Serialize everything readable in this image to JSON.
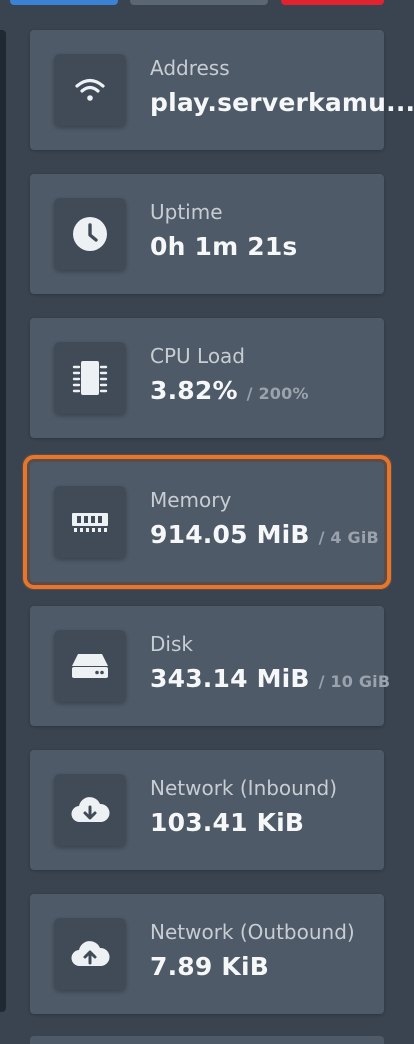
{
  "stats": [
    {
      "icon": "wifi-icon",
      "label": "Address",
      "value": "play.serverkamu....",
      "limit": ""
    },
    {
      "icon": "clock-icon",
      "label": "Uptime",
      "value": "0h 1m 21s",
      "limit": ""
    },
    {
      "icon": "cpu-chip-icon",
      "label": "CPU Load",
      "value": "3.82%",
      "limit": "/ 200%"
    },
    {
      "icon": "memory-icon",
      "label": "Memory",
      "value": "914.05 MiB",
      "limit": "/ 4 GiB"
    },
    {
      "icon": "hard-drive-icon",
      "label": "Disk",
      "value": "343.14 MiB",
      "limit": "/ 10 GiB"
    },
    {
      "icon": "cloud-download-icon",
      "label": "Network (Inbound)",
      "value": "103.41 KiB",
      "limit": ""
    },
    {
      "icon": "cloud-upload-icon",
      "label": "Network (Outbound)",
      "value": "7.89 KiB",
      "limit": ""
    }
  ],
  "colors": {
    "background": "#3a4450",
    "card": "#4e5a67",
    "icon_box": "#414b57",
    "highlight": "#e8762a",
    "button_primary": "#3b82d6",
    "button_secondary": "#5a6672",
    "button_danger": "#e0232f"
  }
}
